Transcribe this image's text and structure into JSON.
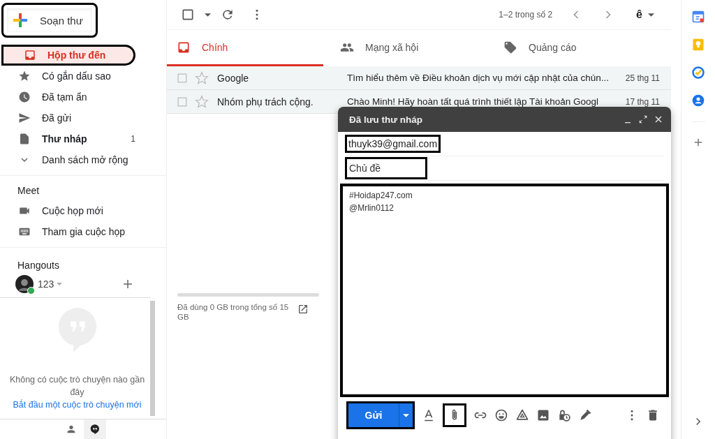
{
  "compose_button": {
    "label": "Soạn thư"
  },
  "nav": [
    {
      "label": "Hộp thư đến",
      "kind": "inbox",
      "selected": true,
      "bold": true
    },
    {
      "label": "Có gắn dấu sao",
      "kind": "star",
      "selected": false,
      "bold": false
    },
    {
      "label": "Đã tạm ẩn",
      "kind": "clock",
      "selected": false,
      "bold": false
    },
    {
      "label": "Đã gửi",
      "kind": "send",
      "selected": false,
      "bold": false
    },
    {
      "label": "Thư nháp",
      "kind": "file",
      "selected": false,
      "bold": true,
      "count": "1"
    },
    {
      "label": "Danh sách mở rộng",
      "kind": "chevron",
      "selected": false,
      "bold": false
    }
  ],
  "meet": {
    "title": "Meet",
    "items": [
      {
        "label": "Cuộc họp mới",
        "kind": "video"
      },
      {
        "label": "Tham gia cuộc họp",
        "kind": "keyboard"
      }
    ]
  },
  "hangouts": {
    "title": "Hangouts",
    "user": "123",
    "online": true,
    "empty_text": "Không có cuộc trò chuyện nào gần đây",
    "link": "Bắt đầu một cuộc trò chuyện mới",
    "bottom_tabs": [
      {
        "kind": "person",
        "selected": false
      },
      {
        "kind": "chat",
        "selected": true
      }
    ]
  },
  "toolbar": {
    "range": "1–2 trong số 2",
    "input_tool": "ê"
  },
  "tabs": [
    {
      "label": "Chính",
      "kind": "inbox",
      "selected": true
    },
    {
      "label": "Mạng xã hội",
      "kind": "people",
      "selected": false
    },
    {
      "label": "Quảng cáo",
      "kind": "tag",
      "selected": false
    }
  ],
  "emails": [
    {
      "sender": "Google",
      "subject": "Tìm hiểu thêm về Điều khoản dịch vụ mới cập nhật của chún...",
      "date": "25 thg 11"
    },
    {
      "sender": "Nhóm phụ trách cộng.",
      "subject": "Chào Minh! Hãy hoàn tất quá trình thiết lập Tài khoản Googl",
      "date": "17 thg 11"
    }
  ],
  "storage": {
    "text": "Đã dùng 0 GB trong tổng số 15 GB"
  },
  "compose": {
    "title": "Đã lưu thư nháp",
    "to": "thuyk39@gmail.com",
    "subject_placeholder": "Chủ đề",
    "body": [
      "#Hoidap247.com",
      "@Mrlin0112"
    ],
    "send": "Gửi"
  }
}
